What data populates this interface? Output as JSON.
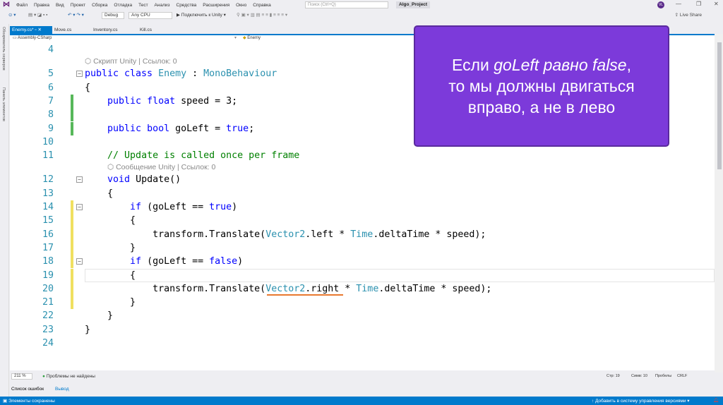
{
  "menu": {
    "items": [
      "Файл",
      "Правка",
      "Вид",
      "Проект",
      "Сборка",
      "Отладка",
      "Тест",
      "Анализ",
      "Средства",
      "Расширения",
      "Окно",
      "Справка"
    ],
    "search_placeholder": "Поиск (Ctrl+Q)",
    "project_name": "Algo_Project",
    "avatar_initials": "VL"
  },
  "toolbar": {
    "config": "Debug",
    "platform": "Any CPU",
    "run_label": "▶ Подключить к Unity ▾",
    "live_share": "Live Share"
  },
  "side_panels": [
    "Обозреватель серверов",
    "Панель элементов"
  ],
  "tabs": [
    {
      "label": "Enemy.cs*",
      "active": true
    },
    {
      "label": "Move.cs"
    },
    {
      "label": "Inventory.cs"
    },
    {
      "label": "Kill.cs"
    }
  ],
  "navbar": {
    "project": "Assembly-CSharp",
    "class": "Enemy"
  },
  "code": [
    {
      "n": "4",
      "t": []
    },
    {
      "lens": "Скрипт Unity | Ссылок: 0",
      "indent": 0
    },
    {
      "n": "5",
      "fold": true,
      "t": [
        [
          "kw",
          "public class "
        ],
        [
          "ty",
          "Enemy"
        ],
        [
          "pl",
          " : "
        ],
        [
          "ty",
          "MonoBehaviour"
        ]
      ]
    },
    {
      "n": "6",
      "t": [
        [
          "pl",
          "{"
        ]
      ]
    },
    {
      "n": "7",
      "mark": "green",
      "t": [
        [
          "pl",
          "    "
        ],
        [
          "kw",
          "public float"
        ],
        [
          "pl",
          " speed = 3;"
        ]
      ]
    },
    {
      "n": "8",
      "mark": "green",
      "t": []
    },
    {
      "n": "9",
      "mark": "green",
      "t": [
        [
          "pl",
          "    "
        ],
        [
          "kw",
          "public bool"
        ],
        [
          "pl",
          " goLeft = "
        ],
        [
          "kw",
          "true"
        ],
        [
          "pl",
          ";"
        ]
      ]
    },
    {
      "n": "10",
      "t": []
    },
    {
      "n": "11",
      "t": [
        [
          "pl",
          "    "
        ],
        [
          "cm",
          "// Update is called once per frame"
        ]
      ]
    },
    {
      "lens": "Сообщение Unity | Ссылок: 0",
      "indent": 4
    },
    {
      "n": "12",
      "fold": true,
      "t": [
        [
          "pl",
          "    "
        ],
        [
          "kw",
          "void"
        ],
        [
          "pl",
          " Update()"
        ]
      ]
    },
    {
      "n": "13",
      "t": [
        [
          "pl",
          "    {"
        ]
      ]
    },
    {
      "n": "14",
      "fold": true,
      "mark": "yellow",
      "t": [
        [
          "pl",
          "        "
        ],
        [
          "kw",
          "if"
        ],
        [
          "pl",
          " (goLeft == "
        ],
        [
          "kw",
          "true"
        ],
        [
          "pl",
          ")"
        ]
      ]
    },
    {
      "n": "15",
      "mark": "yellow",
      "t": [
        [
          "pl",
          "        {"
        ]
      ]
    },
    {
      "n": "16",
      "mark": "yellow",
      "t": [
        [
          "pl",
          "            transform.Translate("
        ],
        [
          "ty",
          "Vector2"
        ],
        [
          "pl",
          ".left * "
        ],
        [
          "ty",
          "Time"
        ],
        [
          "pl",
          ".deltaTime * speed);"
        ]
      ]
    },
    {
      "n": "17",
      "mark": "yellow",
      "t": [
        [
          "pl",
          "        }"
        ]
      ]
    },
    {
      "n": "18",
      "fold": true,
      "mark": "yellow",
      "t": [
        [
          "pl",
          "        "
        ],
        [
          "kw",
          "if"
        ],
        [
          "pl",
          " (goLeft == "
        ],
        [
          "kw",
          "false"
        ],
        [
          "pl",
          ")"
        ]
      ]
    },
    {
      "n": "19",
      "mark": "yellow",
      "current": true,
      "t": [
        [
          "pl",
          "        {"
        ]
      ]
    },
    {
      "n": "20",
      "mark": "yellow",
      "t": [
        [
          "pl",
          "            transform.Translate("
        ],
        [
          "ty",
          "Vector2"
        ],
        [
          "pl",
          ".right * "
        ],
        [
          "ty",
          "Time"
        ],
        [
          "pl",
          ".deltaTime * speed);"
        ]
      ]
    },
    {
      "n": "21",
      "mark": "yellow",
      "t": [
        [
          "pl",
          "        }"
        ]
      ]
    },
    {
      "n": "22",
      "t": [
        [
          "pl",
          "    }"
        ]
      ]
    },
    {
      "n": "23",
      "t": [
        [
          "pl",
          "}"
        ]
      ]
    },
    {
      "n": "24",
      "t": []
    }
  ],
  "callout": {
    "line1_pre": "Если ",
    "line1_em": "goLeft равно false",
    "line1_post": ",",
    "line2": "то мы должны двигаться",
    "line3": "вправо, а не в лево"
  },
  "editor_status": {
    "zoom": "211 %",
    "issues": "Проблемы не найдены",
    "line": "Стр: 19",
    "col": "Симв: 10",
    "spaces": "Пробелы",
    "eol": "CRLF"
  },
  "output_tabs": [
    "Список ошибок",
    "Вывод"
  ],
  "statusbar": {
    "left": "Элементы сохранены",
    "right": "↑ Добавить в систему управления версиями ▾"
  },
  "colors": {
    "accent": "#007acc",
    "callout": "#7c3ada",
    "keyword": "#0000ff",
    "type": "#2b91af",
    "comment": "#008000"
  }
}
